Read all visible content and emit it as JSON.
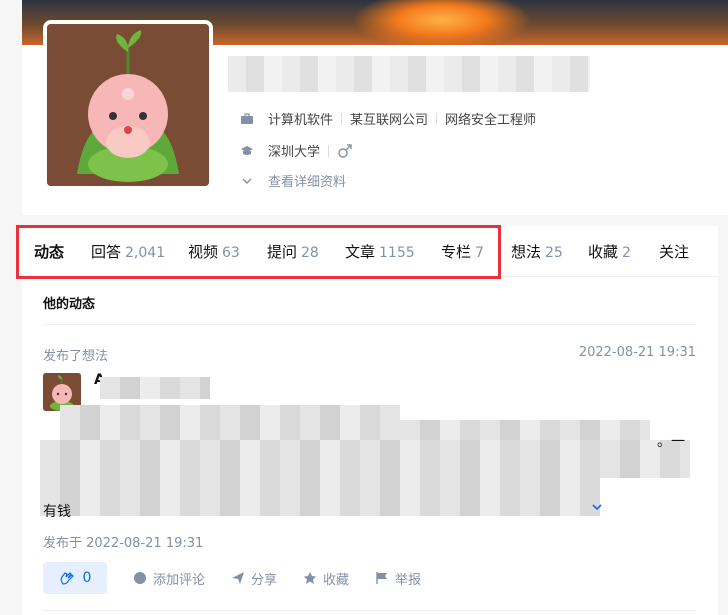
{
  "profile": {
    "info_row_1": [
      "计算机软件",
      "某互联网公司",
      "网络安全工程师"
    ],
    "info_row_2": {
      "school": "深圳大学",
      "gender_icon": "male-icon"
    },
    "more_link": "查看详细资料"
  },
  "tabs": [
    {
      "label": "动态",
      "count": "",
      "active": true
    },
    {
      "label": "回答",
      "count": "2,041"
    },
    {
      "label": "视频",
      "count": "63"
    },
    {
      "label": "提问",
      "count": "28"
    },
    {
      "label": "文章",
      "count": "1155"
    },
    {
      "label": "专栏",
      "count": "7"
    },
    {
      "label": "想法",
      "count": "25"
    },
    {
      "label": "收藏",
      "count": "2"
    },
    {
      "label": "关注",
      "count": ""
    }
  ],
  "feed": {
    "section_title": "他的动态",
    "item": {
      "action": "发布了想法",
      "timestamp": "2022-08-21 19:31",
      "author_partial": "A",
      "visible_text_fragments": [
        "。一",
        "有钱",
        "。"
      ],
      "published": "发布于 2022-08-21 19:31",
      "like_count": "0",
      "actions": [
        "添加评论",
        "分享",
        "收藏",
        "举报"
      ]
    }
  },
  "colors": {
    "highlight": "#e8313a",
    "accent": "#056de8",
    "muted": "#8590a6"
  }
}
